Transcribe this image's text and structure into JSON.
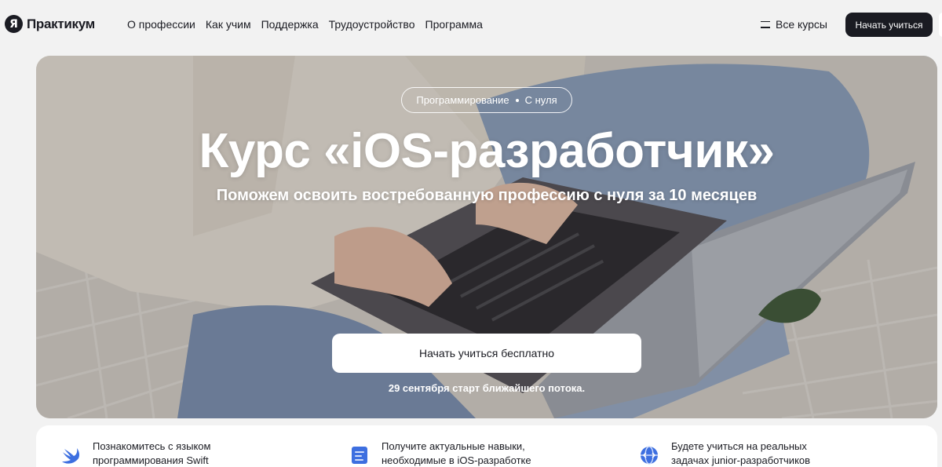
{
  "header": {
    "logo_mark": "Я",
    "logo_text": "Практикум",
    "nav": [
      "О профессии",
      "Как учим",
      "Поддержка",
      "Трудоустройство",
      "Программа"
    ],
    "all_courses_label": "Все курсы",
    "start_button_label": "Начать учиться"
  },
  "hero": {
    "tag_category": "Программирование",
    "tag_level": "С нуля",
    "title": "Курс «iOS-разработчик»",
    "subtitle": "Поможем освоить востребованную профессию с нуля за 10 месяцев",
    "cta_label": "Начать учиться бесплатно",
    "cta_note": "29 сентября старт ближайшего потока."
  },
  "features": [
    {
      "icon": "swift-bird-icon",
      "line1": "Познакомитесь с языком",
      "line2": "программирования Swift"
    },
    {
      "icon": "document-code-icon",
      "line1": "Получите актуальные навыки,",
      "line2": "необходимые в iOS-разработке"
    },
    {
      "icon": "globe-code-icon",
      "line1": "Будете учиться на реальных",
      "line2": "задачах junior-разработчиков"
    }
  ],
  "colors": {
    "brand_dark": "#1a1b22",
    "page_bg": "#f2f2f2",
    "accent_blue": "#3d6fe0"
  }
}
